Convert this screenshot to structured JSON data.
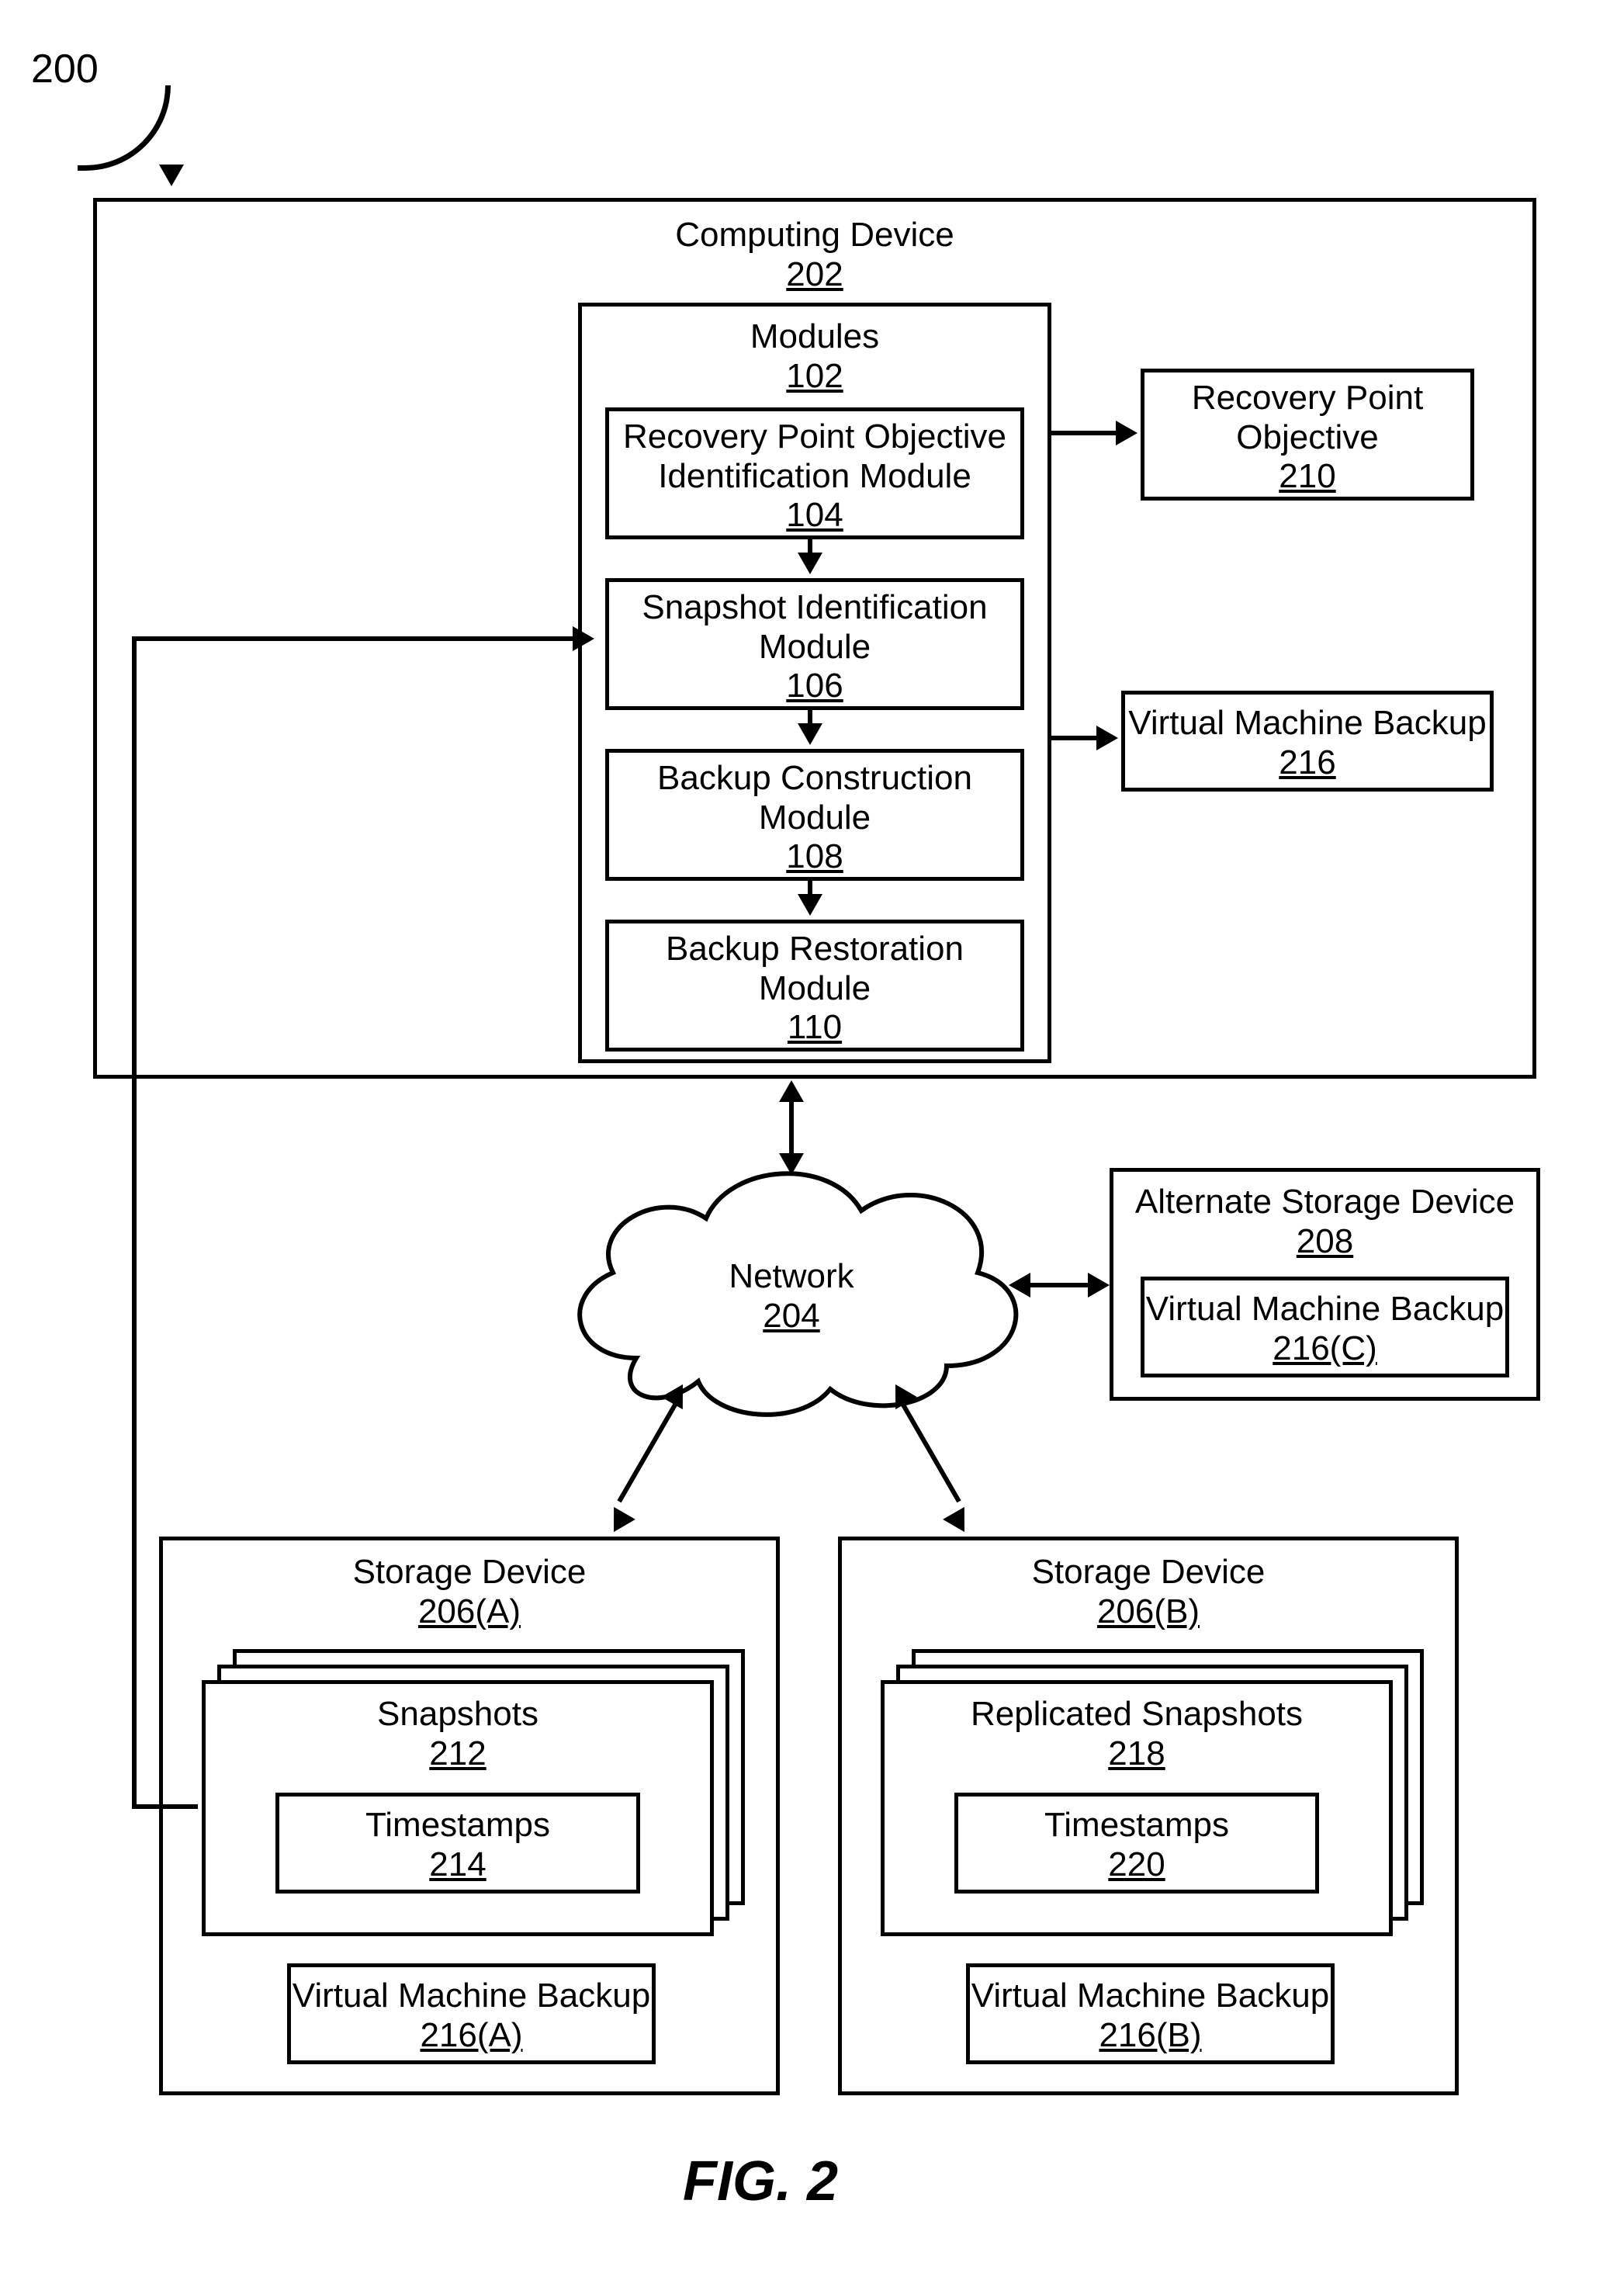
{
  "figure": {
    "ref": "200",
    "caption": "FIG. 2"
  },
  "computingDevice": {
    "title": "Computing Device",
    "ref": "202"
  },
  "modules": {
    "title": "Modules",
    "ref": "102",
    "rpoId": {
      "title1": "Recovery Point Objective",
      "title2": "Identification Module",
      "ref": "104"
    },
    "snapId": {
      "title1": "Snapshot Identification",
      "title2": "Module",
      "ref": "106"
    },
    "bcon": {
      "title1": "Backup Construction",
      "title2": "Module",
      "ref": "108"
    },
    "brest": {
      "title1": "Backup Restoration",
      "title2": "Module",
      "ref": "110"
    }
  },
  "rpo": {
    "title1": "Recovery Point",
    "title2": "Objective",
    "ref": "210"
  },
  "vmb": {
    "title": "Virtual Machine Backup",
    "ref": "216"
  },
  "network": {
    "title": "Network",
    "ref": "204"
  },
  "altStorage": {
    "title": "Alternate Storage Device",
    "ref": "208",
    "vmb": {
      "title": "Virtual Machine Backup",
      "ref": "216(C)"
    }
  },
  "storageA": {
    "title": "Storage Device",
    "ref": "206(A)",
    "snapshots": {
      "title": "Snapshots",
      "ref": "212",
      "timestamps": {
        "title": "Timestamps",
        "ref": "214"
      }
    },
    "vmb": {
      "title": "Virtual Machine Backup",
      "ref": "216(A)"
    }
  },
  "storageB": {
    "title": "Storage Device",
    "ref": "206(B)",
    "snapshots": {
      "title": "Replicated Snapshots",
      "ref": "218",
      "timestamps": {
        "title": "Timestamps",
        "ref": "220"
      }
    },
    "vmb": {
      "title": "Virtual Machine Backup",
      "ref": "216(B)"
    }
  }
}
